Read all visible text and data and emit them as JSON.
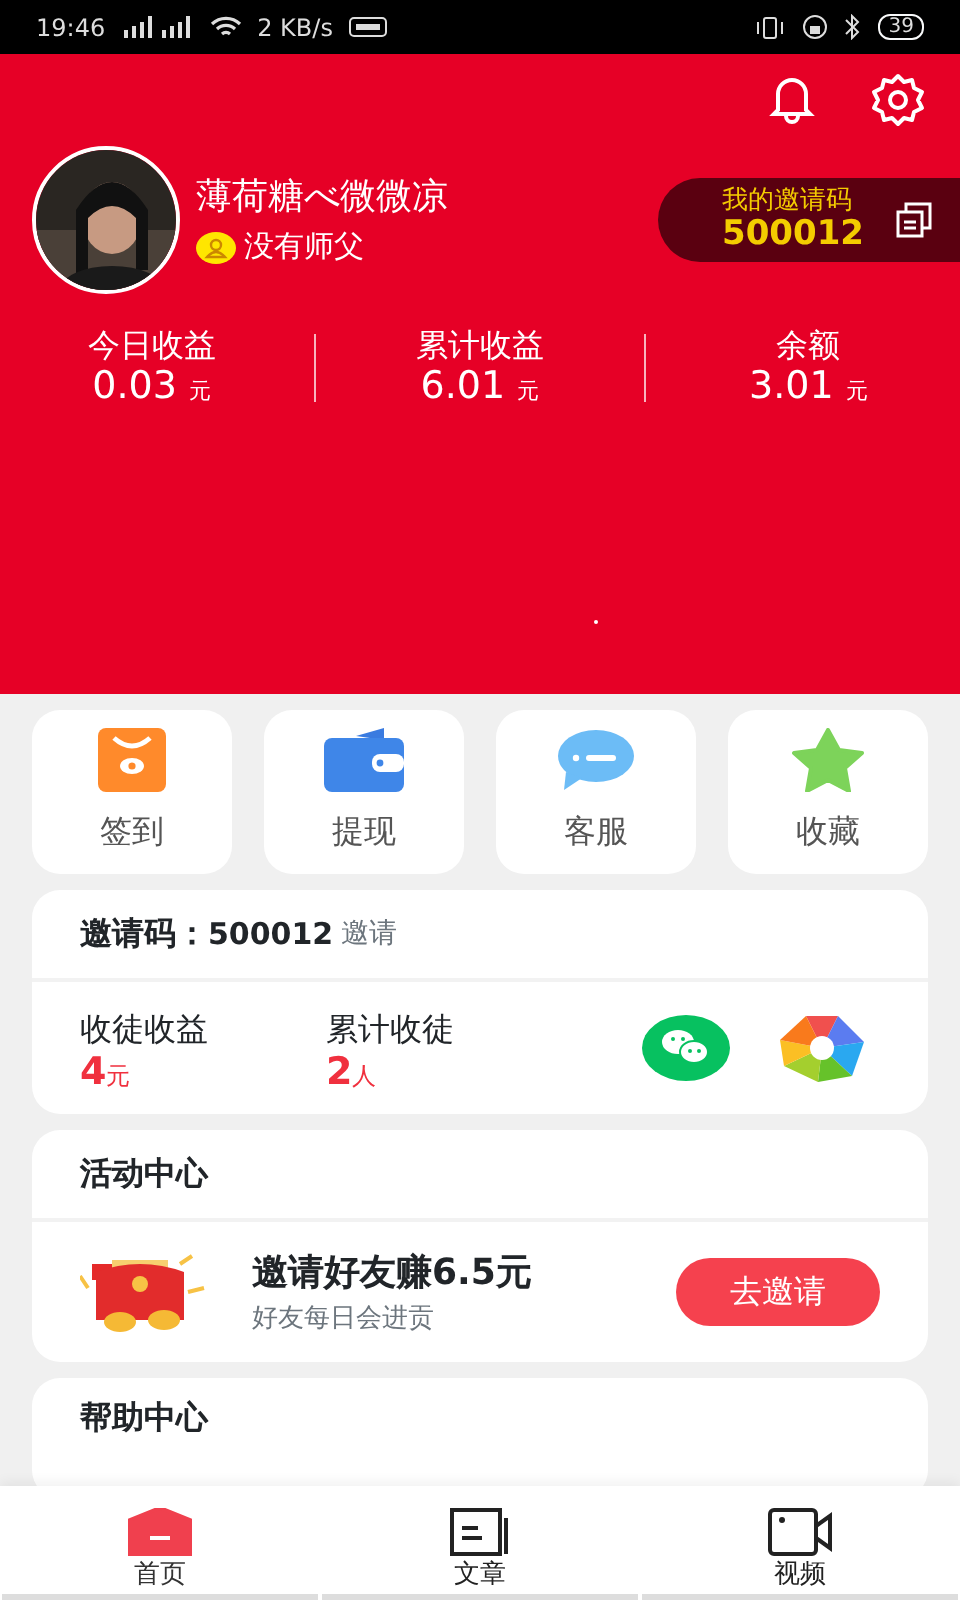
{
  "status_bar": {
    "time": "19:46",
    "speed": "2 KB/s",
    "battery": "39"
  },
  "profile": {
    "name": "薄荷糖べ微微凉",
    "master": "没有师父"
  },
  "invite_pill": {
    "label": "我的邀请码",
    "code": "500012"
  },
  "stats": [
    {
      "label": "今日收益",
      "value": "0.03",
      "unit": "元"
    },
    {
      "label": "累计收益",
      "value": "6.01",
      "unit": "元"
    },
    {
      "label": "余额",
      "value": "3.01",
      "unit": "元"
    }
  ],
  "quick_actions": [
    {
      "label": "签到",
      "kind": "checkin"
    },
    {
      "label": "提现",
      "kind": "wallet"
    },
    {
      "label": "客服",
      "kind": "chat"
    },
    {
      "label": "收藏",
      "kind": "star"
    }
  ],
  "invite_card": {
    "label": "邀请码：",
    "code": "500012",
    "link": "邀请",
    "stats": [
      {
        "label": "收徒收益",
        "value": "4",
        "unit": "元"
      },
      {
        "label": "累计收徒",
        "value": "2",
        "unit": "人"
      }
    ]
  },
  "activity": {
    "title": "活动中心",
    "headline": "邀请好友赚6.5元",
    "subtitle": "好友每日会进贡",
    "button": "去邀请"
  },
  "help": {
    "title": "帮助中心"
  },
  "tabs": [
    {
      "label": "首页",
      "kind": "home",
      "selected": true
    },
    {
      "label": "文章",
      "kind": "article",
      "selected": false
    },
    {
      "label": "视频",
      "kind": "video",
      "selected": false
    }
  ]
}
